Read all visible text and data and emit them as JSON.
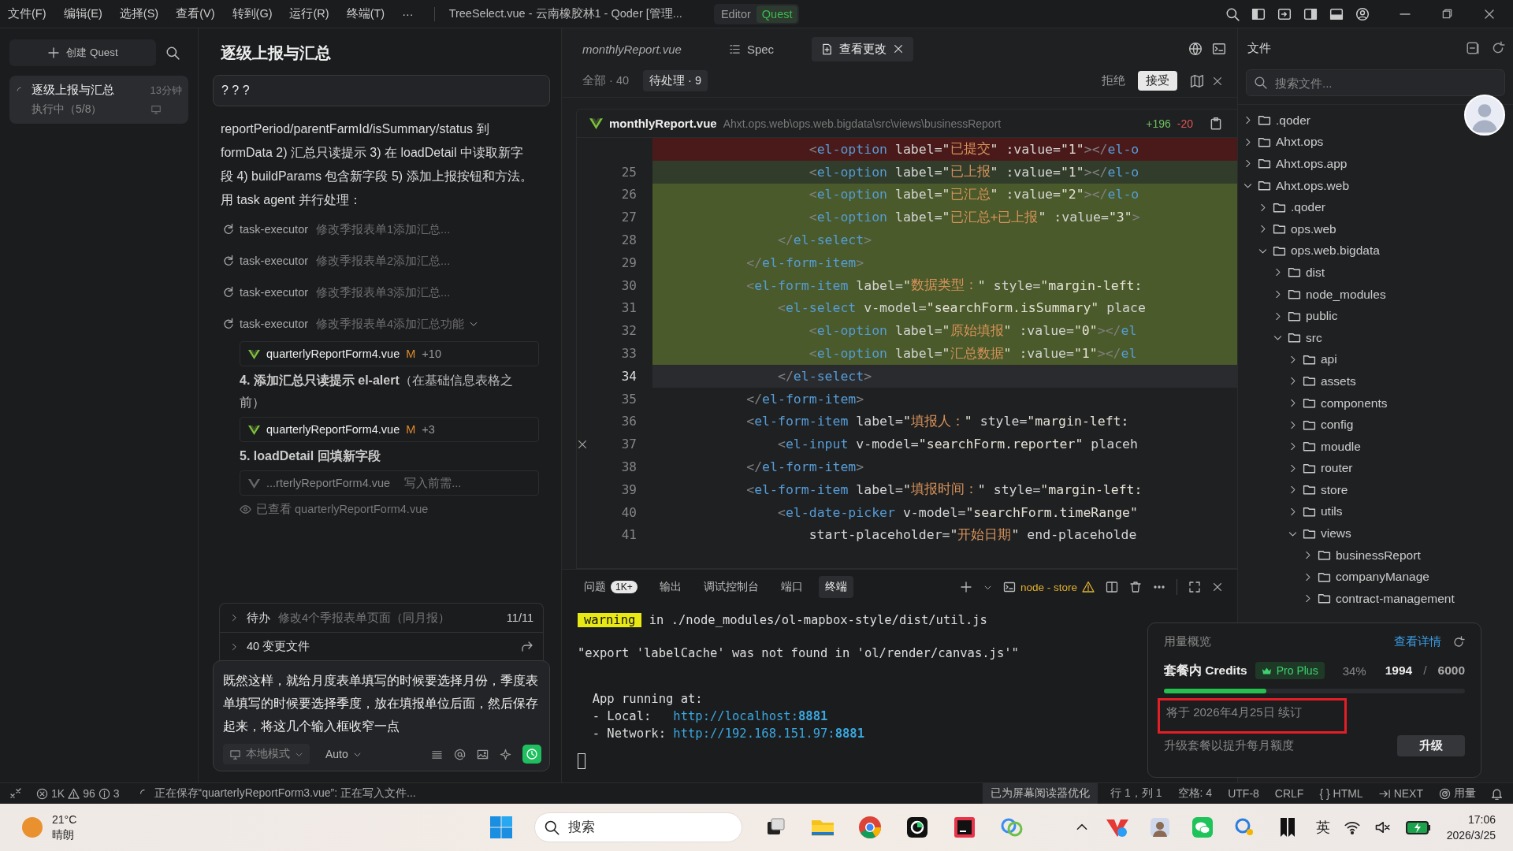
{
  "title_bar": {
    "menu": [
      "文件(F)",
      "编辑(E)",
      "选择(S)",
      "查看(V)",
      "转到(G)",
      "运行(R)",
      "终端(T)"
    ],
    "overflow": "···",
    "window_title": "TreeSelect.vue - 云南橡胶林1 - Qoder [管理...",
    "modes": [
      {
        "label": "Editor",
        "selected": false
      },
      {
        "label": "Quest",
        "selected": true
      }
    ]
  },
  "quests": {
    "create_label": "创建 Quest",
    "items": [
      {
        "title": "逐级上报与汇总",
        "age": "13分钟",
        "status": "执行中（5/8）",
        "selected": true
      }
    ]
  },
  "chat": {
    "title": "逐级上报与汇总",
    "question": "? ? ?",
    "paragraph": "reportPeriod/parentFarmId/isSummary/status 到 formData 2) 汇总只读提示 3) 在 loadDetail 中读取新字段 4) buildParams 包含新字段 5) 添加上报按钮和方法。用 task agent 并行处理：",
    "tasks": [
      {
        "agent": "task-executor",
        "summary": "修改季报表单1添加汇总...",
        "expanded": false
      },
      {
        "agent": "task-executor",
        "summary": "修改季报表单2添加汇总...",
        "expanded": false
      },
      {
        "agent": "task-executor",
        "summary": "修改季报表单3添加汇总...",
        "expanded": false
      },
      {
        "agent": "task-executor",
        "summary": "修改季报表单4添加汇总功能",
        "expanded": true,
        "steps": [
          {
            "kind": "file",
            "name": "quarterlyReportForm4.vue",
            "status": "M",
            "delta": "+10",
            "pending": false
          },
          {
            "kind": "heading",
            "title": "4. 添加汇总只读提示 el-alert",
            "note": "（在基础信息表格之前）"
          },
          {
            "kind": "file",
            "name": "quarterlyReportForm4.vue",
            "status": "M",
            "delta": "+3",
            "pending": false
          },
          {
            "kind": "heading",
            "title": "5. loadDetail 回填新字段"
          },
          {
            "kind": "file",
            "name": "...rterlyReportForm4.vue",
            "note": "写入前需...",
            "pending": true
          },
          {
            "kind": "viewed",
            "text": "已查看 quarterlyReportForm4.vue"
          }
        ]
      }
    ],
    "todo": {
      "label": "待办",
      "summary": "修改4个季报表单页面（同月报）",
      "count": "11/11"
    },
    "changes": {
      "label": "40 变更文件"
    },
    "composer": {
      "text": "既然这样，就给月度表单填写的时候要选择月份，季度表单填写的时候要选择季度，放在填报单位后面，然后保存起来，将这几个输入框收窄一点",
      "mode": "本地模式",
      "model": "Auto"
    }
  },
  "editor": {
    "tabs": [
      {
        "label": "monthlyReport.vue",
        "kind": "preview",
        "selected": false
      },
      {
        "label": "Spec",
        "kind": "spec",
        "selected": false
      },
      {
        "label": "查看更改",
        "kind": "diff",
        "selected": true
      }
    ],
    "filters": [
      {
        "label": "全部 · 40",
        "selected": false
      },
      {
        "label": "待处理 · 9",
        "selected": true
      }
    ],
    "reject": "拒绝",
    "accept": "接受",
    "file": {
      "name": "monthlyReport.vue",
      "path": "Ahxt.ops.web\\ops.web.bigdata\\src\\views\\businessReport",
      "added": "+196",
      "removed": "-20"
    },
    "lines": [
      {
        "text": "                    <el-option label=\"已提交\" :value=\"1\"></el-o",
        "kind": "removed",
        "current": false,
        "marked": false
      },
      {
        "number": "25",
        "text": "                    <el-option label=\"已上报\" :value=\"1\"></el-o",
        "kind": "modified",
        "current": false,
        "marked": false
      },
      {
        "number": "26",
        "text": "                    <el-option label=\"已汇总\" :value=\"2\"></el-o",
        "kind": "added",
        "current": false,
        "marked": false
      },
      {
        "number": "27",
        "text": "                    <el-option label=\"已汇总+已上报\" :value=\"3\">",
        "kind": "added",
        "current": false,
        "marked": false
      },
      {
        "number": "28",
        "text": "                </el-select>",
        "kind": "added",
        "current": false,
        "marked": false
      },
      {
        "number": "29",
        "text": "            </el-form-item>",
        "kind": "added",
        "current": false,
        "marked": false
      },
      {
        "number": "30",
        "text": "            <el-form-item label=\"数据类型：\" style=\"margin-left:",
        "kind": "added",
        "current": false,
        "marked": false
      },
      {
        "number": "31",
        "text": "                <el-select v-model=\"searchForm.isSummary\" place",
        "kind": "added",
        "current": false,
        "marked": false
      },
      {
        "number": "32",
        "text": "                    <el-option label=\"原始填报\" :value=\"0\"></el",
        "kind": "added",
        "current": false,
        "marked": false
      },
      {
        "number": "33",
        "text": "                    <el-option label=\"汇总数据\" :value=\"1\"></el",
        "kind": "added",
        "current": false,
        "marked": false
      },
      {
        "number": "34",
        "text": "                </el-select>",
        "kind": "none",
        "current": true,
        "marked": false
      },
      {
        "number": "35",
        "text": "            </el-form-item>",
        "kind": "none",
        "current": false,
        "marked": false
      },
      {
        "number": "36",
        "text": "            <el-form-item label=\"填报人：\" style=\"margin-left:",
        "kind": "none",
        "current": false,
        "marked": false
      },
      {
        "number": "37",
        "text": "                <el-input v-model=\"searchForm.reporter\" placeh",
        "kind": "none",
        "current": false,
        "marked": true
      },
      {
        "number": "38",
        "text": "            </el-form-item>",
        "kind": "none",
        "current": false,
        "marked": false
      },
      {
        "number": "39",
        "text": "            <el-form-item label=\"填报时间：\" style=\"margin-left:",
        "kind": "none",
        "current": false,
        "marked": false
      },
      {
        "number": "40",
        "text": "                <el-date-picker v-model=\"searchForm.timeRange\"",
        "kind": "none",
        "current": false,
        "marked": false
      },
      {
        "number": "41",
        "text": "                    start-placeholder=\"开始日期\" end-placeholde",
        "kind": "none",
        "current": false,
        "marked": false
      }
    ]
  },
  "terminal": {
    "tabs": [
      {
        "label": "问题",
        "badge": "1K+",
        "selected": false
      },
      {
        "label": "输出",
        "selected": false
      },
      {
        "label": "调试控制台",
        "selected": false
      },
      {
        "label": "端口",
        "selected": false
      },
      {
        "label": "终端",
        "selected": true
      }
    ],
    "session": "node - store",
    "lines": [
      {
        "kind": "warning",
        "tag": "warning",
        "text": " in ./node_modules/ol-mapbox-style/dist/util.js"
      },
      {
        "kind": "plain",
        "text": "\"export 'labelCache' was not found in 'ol/render/canvas.js'\""
      },
      {
        "kind": "blank"
      },
      {
        "kind": "plain",
        "text": "  App running at:"
      },
      {
        "kind": "url",
        "label": "  - Local:   ",
        "url": "http://localhost:",
        "port": "8881"
      },
      {
        "kind": "url",
        "label": "  - Network: ",
        "url": "http://192.168.151.97:",
        "port": "8881"
      },
      {
        "kind": "cursor"
      }
    ]
  },
  "files": {
    "title": "文件",
    "search_placeholder": "搜索文件...",
    "tree": [
      {
        "name": ".qoder",
        "expanded": false
      },
      {
        "name": "Ahxt.ops",
        "expanded": false
      },
      {
        "name": "Ahxt.ops.app",
        "expanded": false
      },
      {
        "name": "Ahxt.ops.web",
        "expanded": true,
        "children": [
          {
            "name": ".qoder",
            "expanded": false
          },
          {
            "name": "ops.web",
            "expanded": false
          },
          {
            "name": "ops.web.bigdata",
            "expanded": true,
            "children": [
              {
                "name": "dist",
                "expanded": false
              },
              {
                "name": "node_modules",
                "expanded": false
              },
              {
                "name": "public",
                "expanded": false
              },
              {
                "name": "src",
                "expanded": true,
                "children": [
                  {
                    "name": "api",
                    "expanded": false
                  },
                  {
                    "name": "assets",
                    "expanded": false
                  },
                  {
                    "name": "components",
                    "expanded": false
                  },
                  {
                    "name": "config",
                    "expanded": false
                  },
                  {
                    "name": "moudle",
                    "expanded": false
                  },
                  {
                    "name": "router",
                    "expanded": false
                  },
                  {
                    "name": "store",
                    "expanded": false
                  },
                  {
                    "name": "utils",
                    "expanded": false
                  },
                  {
                    "name": "views",
                    "expanded": true,
                    "children": [
                      {
                        "name": "businessReport",
                        "expanded": false
                      },
                      {
                        "name": "companyManage",
                        "expanded": false
                      },
                      {
                        "name": "contract-management",
                        "expanded": false
                      }
                    ]
                  }
                ]
              }
            ]
          }
        ]
      }
    ]
  },
  "usage": {
    "title": "用量概览",
    "details_link": "查看详情",
    "credits_label": "套餐内 Credits",
    "plan": "Pro Plus",
    "percent": "34%",
    "used": "1994",
    "separator": "/",
    "total": "6000",
    "level": 0.34,
    "renewal": "将于 2026年4月25日 续订",
    "upgrade_hint": "升级套餐以提升每月额度",
    "upgrade_button": "升级"
  },
  "status_bar": {
    "errors": "1K",
    "warnings": "96",
    "infos": "3",
    "activity": "正在保存“quarterlyReportForm3.vue”: 正在写入文件...",
    "items": [
      {
        "kind": "highlight",
        "text": "已为屏幕阅读器优化"
      },
      {
        "kind": "text",
        "text": "行 1，列 1"
      },
      {
        "kind": "text",
        "text": "空格: 4"
      },
      {
        "kind": "text",
        "text": "UTF-8"
      },
      {
        "kind": "text",
        "text": "CRLF"
      },
      {
        "kind": "language",
        "text": "{ } HTML"
      },
      {
        "kind": "next",
        "text": "NEXT"
      },
      {
        "kind": "usage",
        "text": "用量"
      }
    ]
  },
  "taskbar": {
    "temperature": "21°C",
    "condition": "晴朗",
    "search_placeholder": "搜索",
    "ime": "英",
    "time": "17:06",
    "date": "2026/3/25"
  }
}
